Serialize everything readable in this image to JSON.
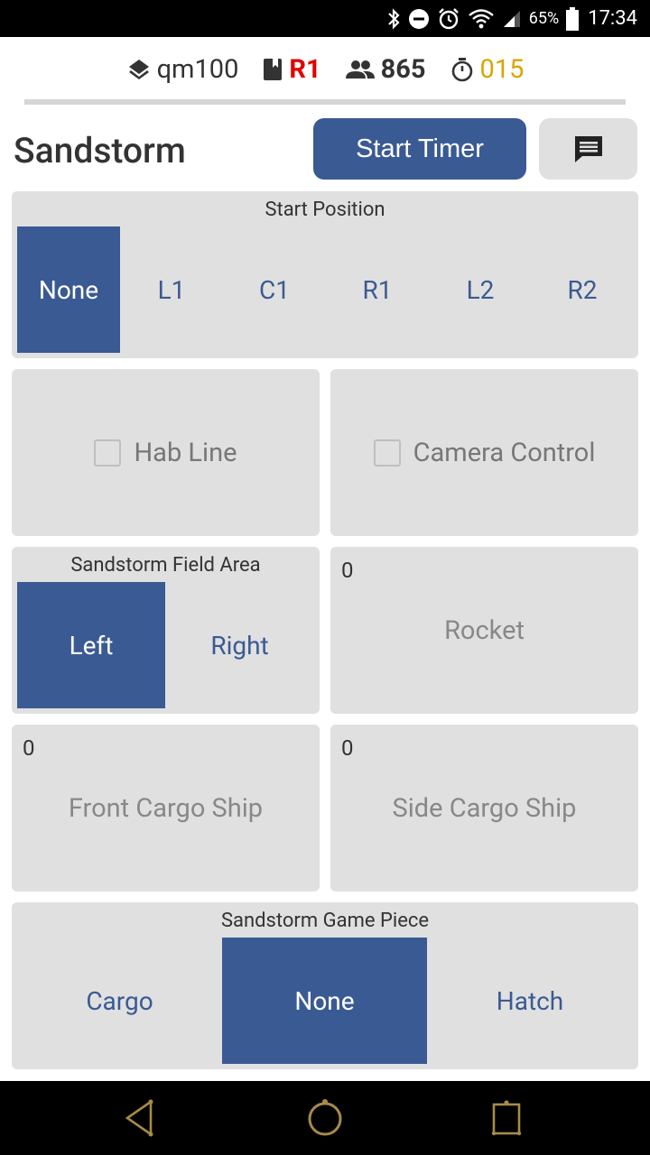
{
  "status_bar": {
    "battery": "65%",
    "time": "17:34",
    "icons": [
      "bluetooth-icon",
      "do-not-disturb-icon",
      "alarm-icon",
      "wifi-icon",
      "signal-icon",
      "battery-icon"
    ]
  },
  "info": {
    "match": "qm100",
    "alliance": "R1",
    "team": "865",
    "timer": "015",
    "colors": {
      "alliance": "#e20000",
      "timer": "#d9a400"
    }
  },
  "header": {
    "title": "Sandstorm",
    "start_timer_label": "Start Timer"
  },
  "start_position": {
    "title": "Start Position",
    "options": [
      "None",
      "L1",
      "C1",
      "R1",
      "L2",
      "R2"
    ],
    "selected": "None"
  },
  "checkboxes": {
    "hab_line": "Hab Line",
    "camera_control": "Camera Control"
  },
  "field_area": {
    "title": "Sandstorm Field Area",
    "options": [
      "Left",
      "Right"
    ],
    "selected": "Left"
  },
  "counters": {
    "rocket": {
      "value": "0",
      "label": "Rocket"
    },
    "front_cargo_ship": {
      "value": "0",
      "label": "Front Cargo Ship"
    },
    "side_cargo_ship": {
      "value": "0",
      "label": "Side Cargo Ship"
    }
  },
  "game_piece": {
    "title": "Sandstorm Game Piece",
    "options": [
      "Cargo",
      "None",
      "Hatch"
    ],
    "selected": "None"
  },
  "theme": {
    "accent": "#3a5a93",
    "panel": "#e0e0e0"
  }
}
